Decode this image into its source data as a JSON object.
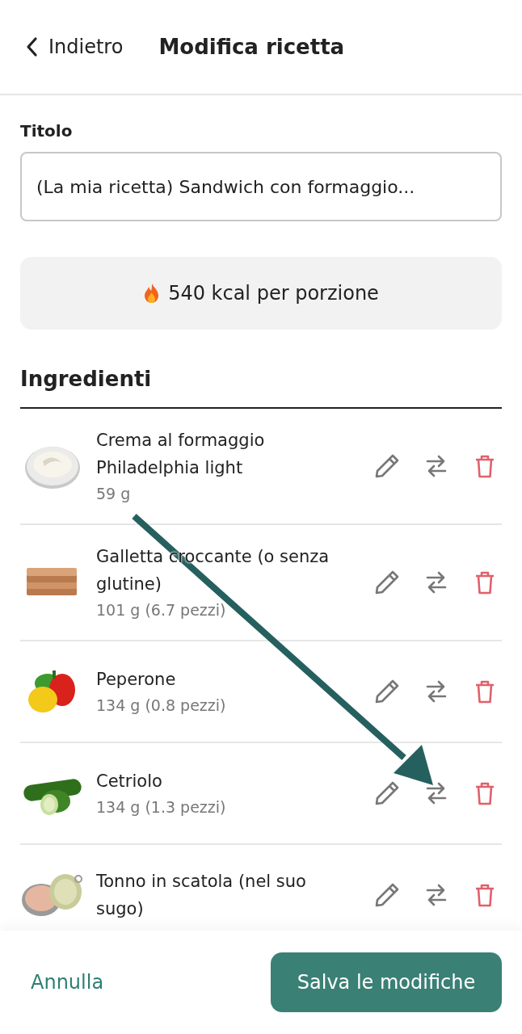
{
  "header": {
    "back": "Indietro",
    "title": "Modifica ricetta"
  },
  "title_field": {
    "label": "Titolo",
    "value": "(La mia ricetta) Sandwich con formaggio..."
  },
  "calories": "540 kcal per porzione",
  "ingredients": {
    "heading": "Ingredienti",
    "items": [
      {
        "name": "Crema al formaggio Philadelphia light",
        "amount": "59 g"
      },
      {
        "name": "Galletta croccante (o senza glutine)",
        "amount": "101 g (6.7 pezzi)"
      },
      {
        "name": "Peperone",
        "amount": "134 g (0.8 pezzi)"
      },
      {
        "name": "Cetriolo",
        "amount": "134 g (1.3 pezzi)"
      },
      {
        "name": "Tonno in scatola (nel suo sugo)"
      }
    ]
  },
  "footer": {
    "cancel": "Annulla",
    "save": "Salva le modifiche"
  }
}
